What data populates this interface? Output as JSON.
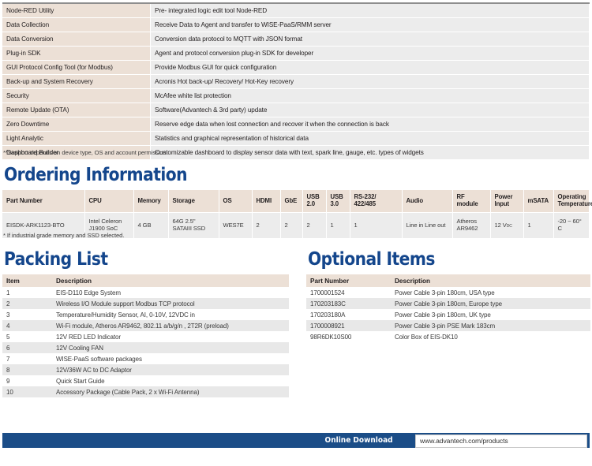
{
  "features_table": {
    "rows": [
      {
        "name": "Node-RED Utility",
        "desc": "Pre- integrated logic edit tool Node-RED"
      },
      {
        "name": "Data Collection",
        "desc": "Receive Data to Agent and transfer to WISE-PaaS/RMM server"
      },
      {
        "name": "Data Conversion",
        "desc": "Conversion data protocol to MQTT with JSON format"
      },
      {
        "name": "Plug-in SDK",
        "desc": "Agent and protocol conversion plug-in SDK for developer"
      },
      {
        "name": "GUI Protocol Config Tool (for Modbus)",
        "desc": "Provide Modbus GUI for quick configuration"
      },
      {
        "name": "Back-up and System Recovery",
        "desc": "Acronis Hot back-up/ Recovery/ Hot-Key recovery"
      },
      {
        "name": "Security",
        "desc": "McAfee white list protection"
      },
      {
        "name": "Remote Update (OTA)",
        "desc": "Software(Advantech & 3rd party) update"
      },
      {
        "name": "Zero Downtime",
        "desc": "Reserve edge data when lost connection and recover it when the connection is back"
      },
      {
        "name": "Light Analytic",
        "desc": "Statistics and graphical representation of historical data"
      },
      {
        "name": "Dashboard Builder",
        "desc": "Customizable dashboard to display sensor data with text, spark line, gauge, etc. types of widgets"
      }
    ],
    "footnote": "**Support depends on device type, OS and account permission."
  },
  "ordering": {
    "title": "Ordering Information",
    "headers": [
      "Part Number",
      "CPU",
      "Memory",
      "Storage",
      "OS",
      "HDMI",
      "GbE",
      "USB 2.0",
      "USB 3.0",
      "RS-232/ 422/485",
      "Audio",
      "RF module",
      "Power Input",
      "mSATA",
      "Operating Temperature*"
    ],
    "row": {
      "part_number": "EISDK-ARK1123-BTO",
      "cpu": "Intel Celeron J1900 SoC",
      "memory": "4 GB",
      "storage": "64G 2.5\" SATAIII SSD",
      "os": "WES7E",
      "hdmi": "2",
      "gbe": "2",
      "usb20": "2",
      "usb30": "1",
      "rs232": "1",
      "audio": "Line in Line out",
      "rf_module": "Atheros AR9462",
      "power_input": "12 V",
      "power_input_sub": "DC",
      "msata": "1",
      "operating_temperature": "-20 ~ 60° C"
    },
    "footnote": "* If industrial grade memory and SSD selected."
  },
  "packing_list": {
    "title": "Packing List",
    "headers": [
      "Item",
      "Description"
    ],
    "rows": [
      {
        "item": "1",
        "desc": "EIS-D110 Edge System"
      },
      {
        "item": "2",
        "desc": "Wireless I/O Module support Modbus TCP protocol"
      },
      {
        "item": "3",
        "desc": "Temperature/Humidity Sensor, AI, 0-10V, 12VDC in"
      },
      {
        "item": "4",
        "desc": "Wi-Fi module, Atheros AR9462, 802.11 a/b/g/n , 2T2R (preload)"
      },
      {
        "item": "5",
        "desc": "12V RED LED Indicator"
      },
      {
        "item": "6",
        "desc": "12V Cooling FAN"
      },
      {
        "item": "7",
        "desc": "WISE-PaaS software packages"
      },
      {
        "item": "8",
        "desc": "12V/36W AC to DC Adaptor"
      },
      {
        "item": "9",
        "desc": "Quick Start Guide"
      },
      {
        "item": "10",
        "desc": "Accessory Package (Cable Pack, 2 x Wi-Fi Antenna)"
      }
    ]
  },
  "optional_items": {
    "title": "Optional Items",
    "headers": [
      "Part Number",
      "Description"
    ],
    "rows": [
      {
        "part": "1700001524",
        "desc": "Power Cable 3-pin 180cm, USA type"
      },
      {
        "part": "170203183C",
        "desc": "Power Cable 3-pin 180cm, Europe type"
      },
      {
        "part": "170203180A",
        "desc": "Power Cable 3-pin 180cm, UK type"
      },
      {
        "part": "1700008921",
        "desc": "Power Cable 3-pin PSE Mark 183cm"
      },
      {
        "part": "98R6DK10S00",
        "desc": "Color Box of EIS-DK10"
      }
    ]
  },
  "footer": {
    "label": "Online Download",
    "url": "www.advantech.com/products"
  },
  "colors": {
    "brand_blue": "#14468c",
    "footer_blue": "#1b4d87",
    "header_beige": "#ece0d6",
    "row_gray": "#ececec"
  }
}
